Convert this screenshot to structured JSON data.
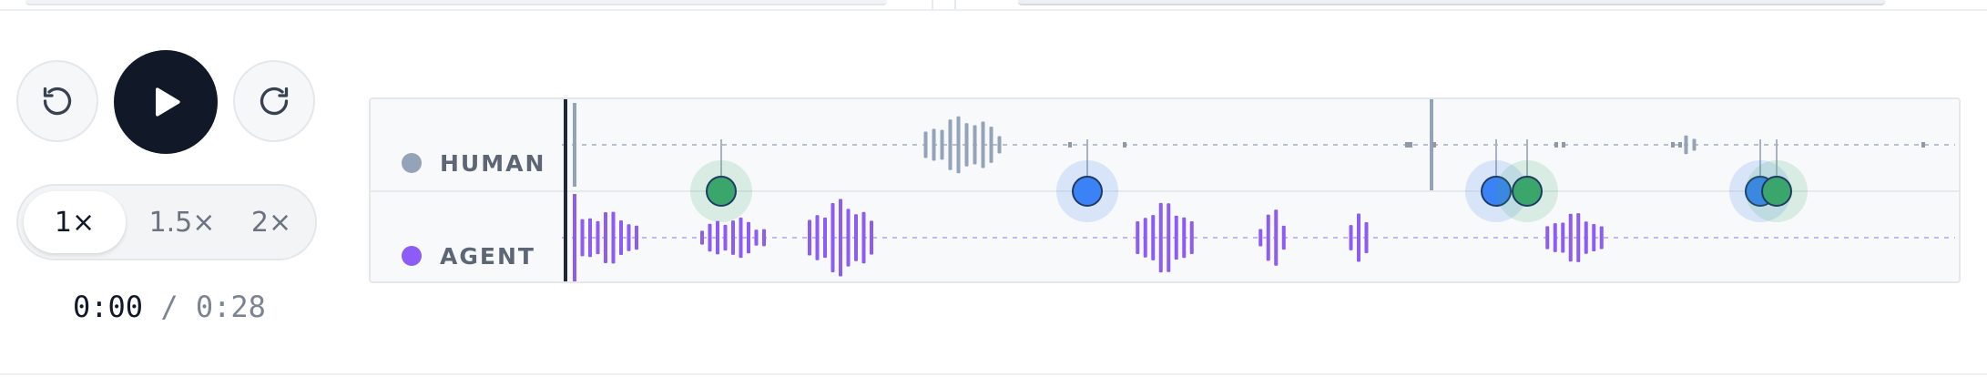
{
  "player": {
    "rewind_icon": "rotate-ccw-icon",
    "play_icon": "play-icon",
    "forward_icon": "rotate-cw-icon",
    "speeds": [
      "1×",
      "1.5×",
      "2×"
    ],
    "active_speed": "1×",
    "current_time": "0:00",
    "time_separator": "/",
    "duration": "0:28"
  },
  "timeline": {
    "tracks": [
      {
        "label": "HUMAN",
        "color": "#94a3b8"
      },
      {
        "label": "AGENT",
        "color": "#8b5cf6"
      }
    ],
    "playhead_position": 0,
    "marker_colors": {
      "blue": "#3b82f6",
      "green": "#3aa66c"
    }
  }
}
